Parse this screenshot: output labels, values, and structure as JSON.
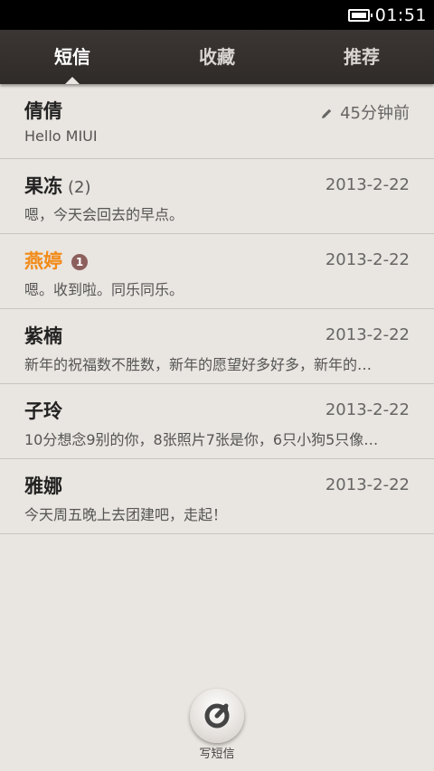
{
  "status_bar": {
    "time": "01:51",
    "battery_icon": "battery-icon"
  },
  "tabs": [
    {
      "label": "短信",
      "active": true
    },
    {
      "label": "收藏",
      "active": false
    },
    {
      "label": "推荐",
      "active": false
    }
  ],
  "messages": [
    {
      "name": "倩倩",
      "time": "45分钟前",
      "preview": "Hello MIUI",
      "draft_icon": "pencil-icon"
    },
    {
      "name": "果冻",
      "count": "(2)",
      "time": "2013-2-22",
      "preview": "嗯，今天会回去的早点。"
    },
    {
      "name": "燕婷",
      "badge": "1",
      "time": "2013-2-22",
      "preview": "嗯。收到啦。同乐同乐。"
    },
    {
      "name": "紫楠",
      "time": "2013-2-22",
      "preview": "新年的祝福数不胜数，新年的愿望好多好多，新年的…"
    },
    {
      "name": "子玲",
      "time": "2013-2-22",
      "preview": "10分想念9别的你，8张照片7张是你，6只小狗5只像…"
    },
    {
      "name": "雅娜",
      "time": "2013-2-22",
      "preview": "今天周五晚上去团建吧，走起！"
    }
  ],
  "compose": {
    "label": "写短信",
    "icon": "compose-icon"
  },
  "colors": {
    "highlight": "#f28a17",
    "tab_bar": "#2f2b29",
    "background": "#e9e5e0"
  }
}
